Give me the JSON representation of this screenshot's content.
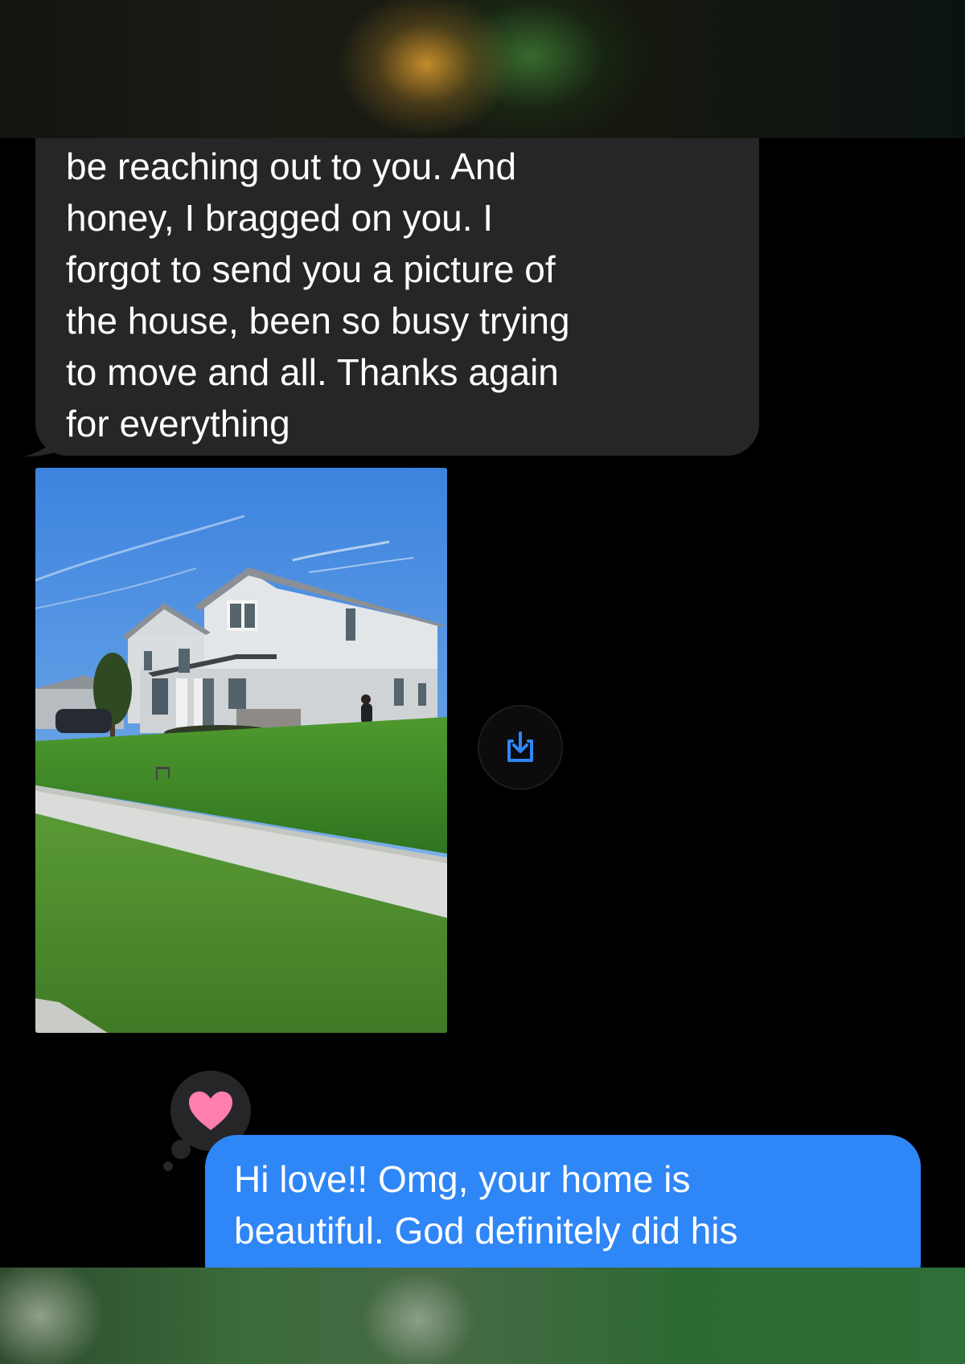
{
  "messages": {
    "incoming": {
      "text": "be reaching out to you. And\nhoney, I bragged on you. I\nforgot to send you a picture of\nthe house, been so busy trying\nto move and all. Thanks again\nfor everything"
    },
    "photo": {
      "subject": "two-story house with green lawn and sidewalk"
    },
    "save_icon": "save-to-photos-icon",
    "tapback": {
      "icon": "pink-heart-icon",
      "color": "#ff7eb0"
    },
    "outgoing": {
      "text": "Hi love!! Omg, your home is\nbeautiful. God definitely did his"
    }
  },
  "colors": {
    "incoming_bubble": "#262628",
    "outgoing_bubble": "#2f86f6",
    "accent_blue": "#2f86f6",
    "background": "#000000"
  }
}
